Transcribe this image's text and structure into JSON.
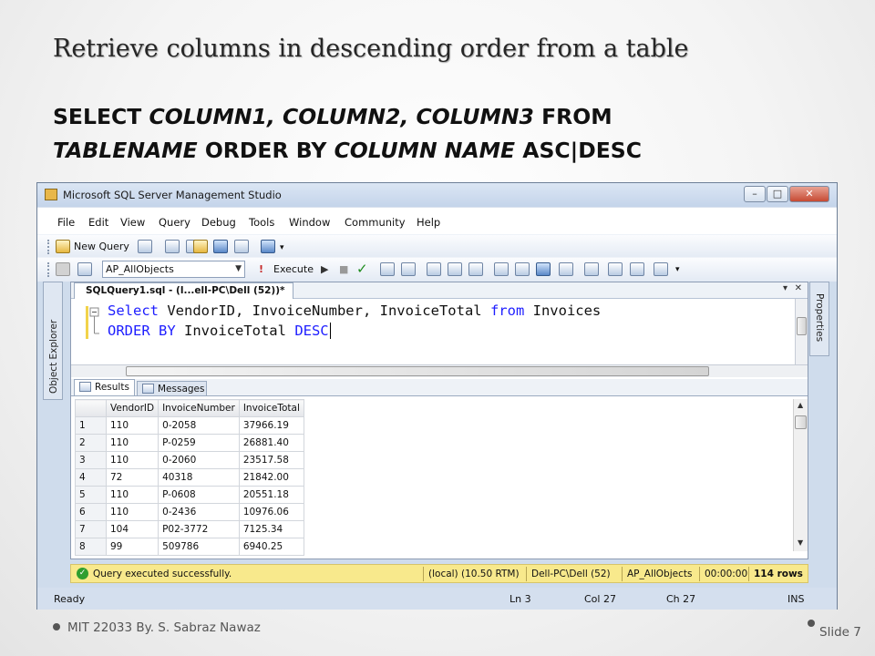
{
  "slide": {
    "title": "Retrieve columns in descending order from a table",
    "sql_line1": {
      "kw1": "SELECT",
      "cols": "COLUMN1, COLUMN2, COLUMN3",
      "kw2": "FROM"
    },
    "sql_line2": {
      "table": "TABLENAME",
      "kw": "ORDER BY",
      "col": "COLUMN NAME",
      "tail": "ASC|DESC"
    },
    "footer_left": "MIT 22033 By. S. Sabraz Nawaz",
    "footer_right": "Slide 7"
  },
  "window": {
    "title": "Microsoft SQL Server Management Studio",
    "controls": {
      "minimize": "–",
      "maximize": "□",
      "close": "✕"
    }
  },
  "menu": [
    "File",
    "Edit",
    "View",
    "Query",
    "Debug",
    "Tools",
    "Window",
    "Community",
    "Help"
  ],
  "toolbar": {
    "new_query": "New Query",
    "database": "AP_AllObjects",
    "execute": "Execute"
  },
  "editor": {
    "tab_title": "SQLQuery1.sql - (l...ell-PC\\Dell (52))*",
    "code": {
      "line1": {
        "kw1": "Select",
        "rest1": " VendorID, InvoiceNumber, InvoiceTotal ",
        "kw2": "from",
        "rest2": " Invoices"
      },
      "line2": {
        "kw1": "ORDER BY",
        "rest1": " InvoiceTotal ",
        "kw2": "DESC"
      }
    }
  },
  "side_panels": {
    "left": "Object Explorer",
    "right": "Properties"
  },
  "results": {
    "tabs": [
      "Results",
      "Messages"
    ],
    "columns": [
      "VendorID",
      "InvoiceNumber",
      "InvoiceTotal"
    ],
    "rows": [
      [
        "1",
        "110",
        "0-2058",
        "37966.19"
      ],
      [
        "2",
        "110",
        "P-0259",
        "26881.40"
      ],
      [
        "3",
        "110",
        "0-2060",
        "23517.58"
      ],
      [
        "4",
        "72",
        "40318",
        "21842.00"
      ],
      [
        "5",
        "110",
        "P-0608",
        "20551.18"
      ],
      [
        "6",
        "110",
        "0-2436",
        "10976.06"
      ],
      [
        "7",
        "104",
        "P02-3772",
        "7125.34"
      ],
      [
        "8",
        "99",
        "509786",
        "6940.25"
      ]
    ]
  },
  "status": {
    "message": "Query executed successfully.",
    "server": "(local) (10.50 RTM)",
    "user": "Dell-PC\\Dell (52)",
    "database": "AP_AllObjects",
    "time": "00:00:00",
    "rows": "114 rows"
  },
  "bottom": {
    "state": "Ready",
    "ln": "Ln 3",
    "col": "Col 27",
    "ch": "Ch 27",
    "mode": "INS"
  }
}
